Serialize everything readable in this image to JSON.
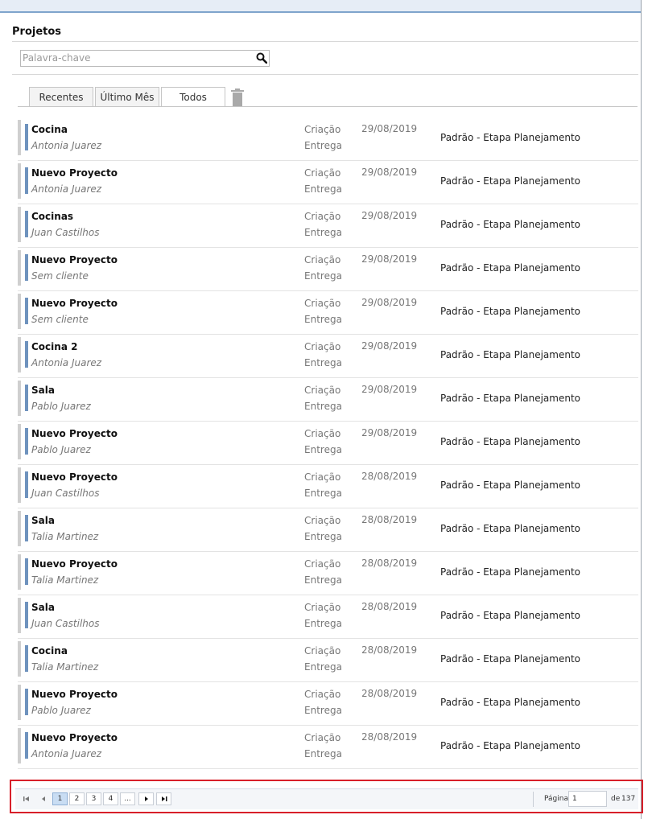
{
  "page": {
    "title": "Projetos"
  },
  "search": {
    "placeholder": "Palavra-chave",
    "value": "",
    "icon": "search-icon"
  },
  "tabs": [
    {
      "label": "Recentes",
      "active": false
    },
    {
      "label": "Último Mês",
      "active": false
    },
    {
      "label": "Todos",
      "active": true
    }
  ],
  "toolbar": {
    "delete_icon": "trash-icon"
  },
  "colors": {
    "accent": "#6f93be",
    "rail": "#cfcfcf",
    "highlight": "#d8202a"
  },
  "projects": [
    {
      "name": "Cocina",
      "client": "Antonia Juarez",
      "created_label": "Criação",
      "delivery_label": "Entrega",
      "created_date": "29/08/2019",
      "stage": "Padrão - Etapa Planejamento"
    },
    {
      "name": "Nuevo Proyecto",
      "client": "Antonia Juarez",
      "created_label": "Criação",
      "delivery_label": "Entrega",
      "created_date": "29/08/2019",
      "stage": "Padrão - Etapa Planejamento"
    },
    {
      "name": "Cocinas",
      "client": "Juan Castilhos",
      "created_label": "Criação",
      "delivery_label": "Entrega",
      "created_date": "29/08/2019",
      "stage": "Padrão - Etapa Planejamento"
    },
    {
      "name": "Nuevo Proyecto",
      "client": "Sem cliente",
      "created_label": "Criação",
      "delivery_label": "Entrega",
      "created_date": "29/08/2019",
      "stage": "Padrão - Etapa Planejamento"
    },
    {
      "name": "Nuevo Proyecto",
      "client": "Sem cliente",
      "created_label": "Criação",
      "delivery_label": "Entrega",
      "created_date": "29/08/2019",
      "stage": "Padrão - Etapa Planejamento"
    },
    {
      "name": "Cocina 2",
      "client": "Antonia Juarez",
      "created_label": "Criação",
      "delivery_label": "Entrega",
      "created_date": "29/08/2019",
      "stage": "Padrão - Etapa Planejamento"
    },
    {
      "name": "Sala",
      "client": "Pablo Juarez",
      "created_label": "Criação",
      "delivery_label": "Entrega",
      "created_date": "29/08/2019",
      "stage": "Padrão - Etapa Planejamento"
    },
    {
      "name": "Nuevo Proyecto",
      "client": "Pablo Juarez",
      "created_label": "Criação",
      "delivery_label": "Entrega",
      "created_date": "29/08/2019",
      "stage": "Padrão - Etapa Planejamento"
    },
    {
      "name": "Nuevo Proyecto",
      "client": "Juan Castilhos",
      "created_label": "Criação",
      "delivery_label": "Entrega",
      "created_date": "28/08/2019",
      "stage": "Padrão - Etapa Planejamento"
    },
    {
      "name": "Sala",
      "client": "Talia Martinez",
      "created_label": "Criação",
      "delivery_label": "Entrega",
      "created_date": "28/08/2019",
      "stage": "Padrão - Etapa Planejamento"
    },
    {
      "name": "Nuevo Proyecto",
      "client": "Talia Martinez",
      "created_label": "Criação",
      "delivery_label": "Entrega",
      "created_date": "28/08/2019",
      "stage": "Padrão - Etapa Planejamento"
    },
    {
      "name": "Sala",
      "client": "Juan Castilhos",
      "created_label": "Criação",
      "delivery_label": "Entrega",
      "created_date": "28/08/2019",
      "stage": "Padrão - Etapa Planejamento"
    },
    {
      "name": "Cocina",
      "client": "Talia Martinez",
      "created_label": "Criação",
      "delivery_label": "Entrega",
      "created_date": "28/08/2019",
      "stage": "Padrão - Etapa Planejamento"
    },
    {
      "name": "Nuevo Proyecto",
      "client": "Pablo Juarez",
      "created_label": "Criação",
      "delivery_label": "Entrega",
      "created_date": "28/08/2019",
      "stage": "Padrão - Etapa Planejamento"
    },
    {
      "name": "Nuevo Proyecto",
      "client": "Antonia Juarez",
      "created_label": "Criação",
      "delivery_label": "Entrega",
      "created_date": "28/08/2019",
      "stage": "Padrão - Etapa Planejamento"
    }
  ],
  "pagination": {
    "first_icon": "first-page-icon",
    "prev_icon": "prev-page-icon",
    "next_icon": "next-page-icon",
    "last_icon": "last-page-icon",
    "pages": [
      "1",
      "2",
      "3",
      "4",
      "..."
    ],
    "current_page_index": 0,
    "page_label": "Página",
    "page_input_value": "1",
    "of_label": "de",
    "total_pages": "137"
  }
}
